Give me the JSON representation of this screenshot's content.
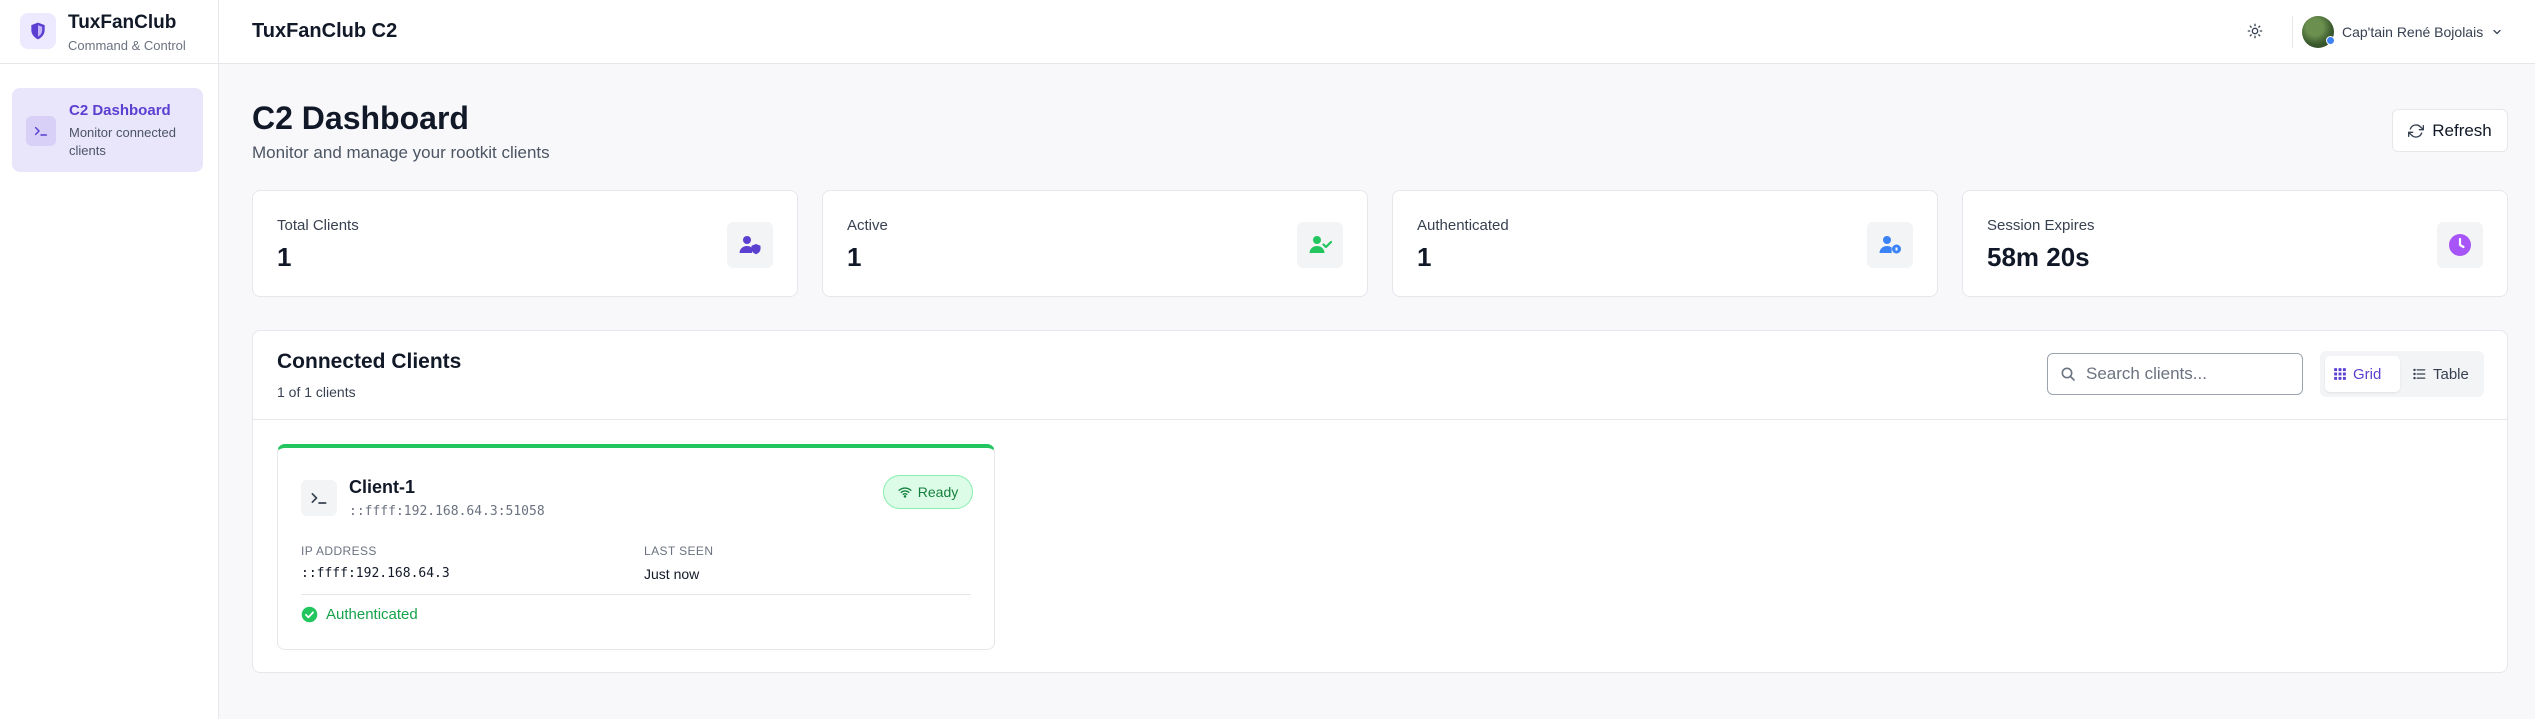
{
  "brand": {
    "title": "TuxFanClub",
    "subtitle": "Command & Control"
  },
  "sidebar": {
    "items": [
      {
        "label": "C2 Dashboard",
        "description": "Monitor connected clients",
        "active": true
      }
    ]
  },
  "topbar": {
    "title": "TuxFanClub C2",
    "user_name": "Cap'tain René Bojolais"
  },
  "page": {
    "title": "C2 Dashboard",
    "subtitle": "Monitor and manage your rootkit clients",
    "refresh_label": "Refresh"
  },
  "stats": [
    {
      "label": "Total Clients",
      "value": "1",
      "icon": "users-shield-icon",
      "color": "#5b3fd1"
    },
    {
      "label": "Active",
      "value": "1",
      "icon": "user-check-icon",
      "color": "#22c55e"
    },
    {
      "label": "Authenticated",
      "value": "1",
      "icon": "user-lock-icon",
      "color": "#3b82f6"
    },
    {
      "label": "Session Expires",
      "value": "58m 20s",
      "icon": "clock-icon",
      "color": "#a855f7"
    }
  ],
  "clients_panel": {
    "title": "Connected Clients",
    "count_text": "1 of 1 clients",
    "search_placeholder": "Search clients...",
    "view_options": [
      "Grid",
      "Table"
    ],
    "selected_view": "Grid"
  },
  "clients": [
    {
      "name": "Client-1",
      "address": "::ffff:192.168.64.3:51058",
      "status": "Ready",
      "ip_label": "IP ADDRESS",
      "ip": "::ffff:192.168.64.3",
      "last_seen_label": "LAST SEEN",
      "last_seen": "Just now",
      "auth_status": "Authenticated"
    }
  ],
  "colors": {
    "accent": "#5b3fd1",
    "success": "#22c55e",
    "info": "#3b82f6"
  }
}
